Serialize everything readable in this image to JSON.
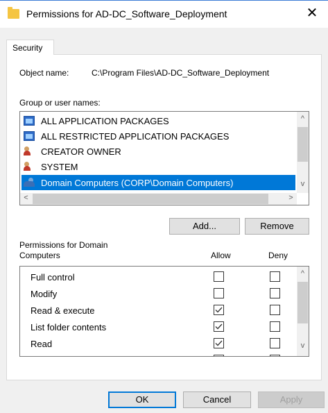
{
  "window": {
    "title": "Permissions for AD-DC_Software_Deployment",
    "close_glyph": "✕"
  },
  "tabs": [
    {
      "label": "Security"
    }
  ],
  "object": {
    "label": "Object name:",
    "value": "C:\\Program Files\\AD-DC_Software_Deployment"
  },
  "groups": {
    "label": "Group or user names:",
    "items": [
      {
        "label": "ALL APPLICATION PACKAGES",
        "icon": "package-icon",
        "selected": false
      },
      {
        "label": "ALL RESTRICTED APPLICATION PACKAGES",
        "icon": "package-icon",
        "selected": false
      },
      {
        "label": "CREATOR OWNER",
        "icon": "user-icon",
        "selected": false
      },
      {
        "label": "SYSTEM",
        "icon": "user-icon",
        "selected": false
      },
      {
        "label": "Domain Computers (CORP\\Domain Computers)",
        "icon": "group-icon",
        "selected": true
      }
    ]
  },
  "buttons": {
    "add": "Add...",
    "remove": "Remove",
    "ok": "OK",
    "cancel": "Cancel",
    "apply": "Apply"
  },
  "permissions": {
    "label_line1": "Permissions for Domain",
    "label_line2": "Computers",
    "allow_header": "Allow",
    "deny_header": "Deny",
    "rows": [
      {
        "name": "Full control",
        "allow": false,
        "deny": false
      },
      {
        "name": "Modify",
        "allow": false,
        "deny": false
      },
      {
        "name": "Read & execute",
        "allow": true,
        "deny": false
      },
      {
        "name": "List folder contents",
        "allow": true,
        "deny": false
      },
      {
        "name": "Read",
        "allow": true,
        "deny": false
      }
    ]
  },
  "colors": {
    "selection": "#0078d7",
    "accent": "#0078d7",
    "folder": "#f5c542"
  }
}
